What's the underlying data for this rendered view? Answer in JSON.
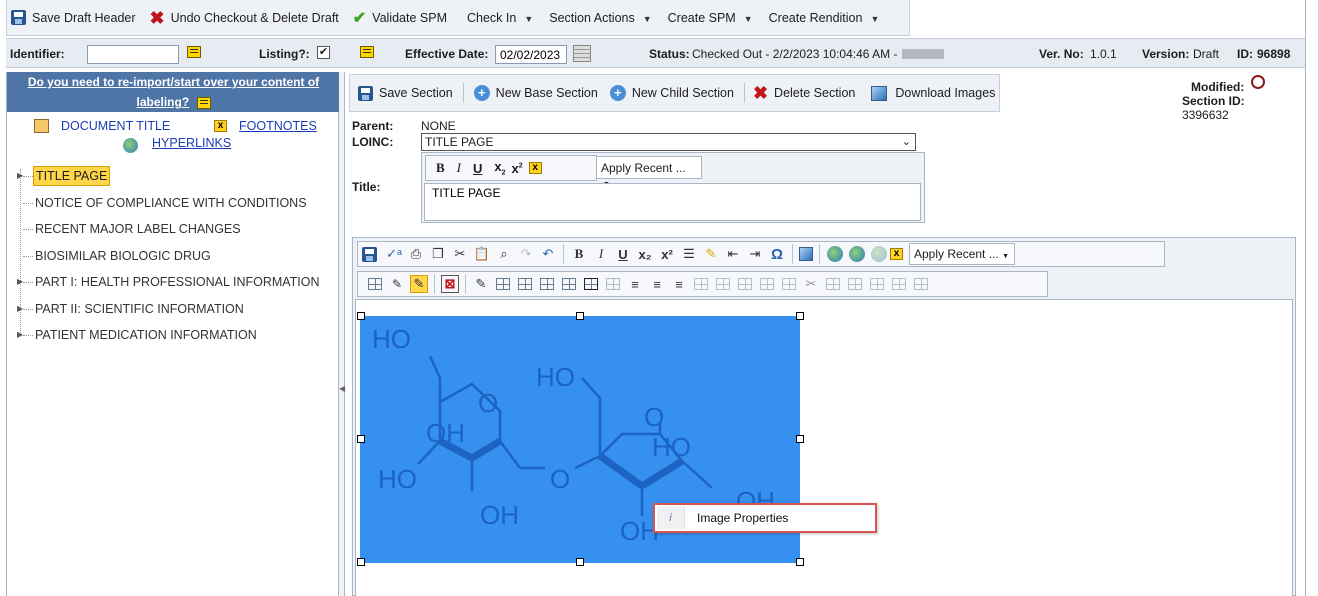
{
  "top_toolbar": {
    "save_draft_header": "Save Draft Header",
    "undo_checkout": "Undo Checkout & Delete Draft",
    "validate_spm": "Validate SPM",
    "check_in": "Check In",
    "section_actions": "Section Actions",
    "create_spm": "Create SPM",
    "create_rendition": "Create Rendition"
  },
  "info_bar": {
    "identifier_label": "Identifier:",
    "identifier_value": "",
    "listing_label": "Listing?:",
    "listing_checked": true,
    "effective_date_label": "Effective Date:",
    "effective_date_value": "02/02/2023",
    "status_label": "Status:",
    "status_value": "Checked Out - 2/2/2023 10:04:46 AM -",
    "ver_no_label": "Ver. No:",
    "ver_no_value": "1.0.1",
    "version_label": "Version:",
    "version_value": "Draft",
    "id_label": "ID:",
    "id_value": "96898"
  },
  "left_panel": {
    "reimport_line1": "Do you need to re-import/start over your content of",
    "reimport_line2": "labeling?",
    "document_title": "DOCUMENT TITLE",
    "footnotes": "FOOTNOTES",
    "hyperlinks": "HYPERLINKS",
    "tree": [
      {
        "label": "TITLE PAGE",
        "selected": true,
        "expandable": true
      },
      {
        "label": "NOTICE OF COMPLIANCE WITH CONDITIONS",
        "selected": false,
        "expandable": false
      },
      {
        "label": "RECENT MAJOR LABEL CHANGES",
        "selected": false,
        "expandable": false
      },
      {
        "label": "BIOSIMILAR BIOLOGIC DRUG",
        "selected": false,
        "expandable": false
      },
      {
        "label": "PART I: HEALTH PROFESSIONAL INFORMATION",
        "selected": false,
        "expandable": true
      },
      {
        "label": "PART II: SCIENTIFIC INFORMATION",
        "selected": false,
        "expandable": true
      },
      {
        "label": "PATIENT MEDICATION INFORMATION",
        "selected": false,
        "expandable": true
      }
    ]
  },
  "section_toolbar": {
    "save_section": "Save Section",
    "new_base_section": "New Base Section",
    "new_child_section": "New Child Section",
    "delete_section": "Delete Section",
    "download_images": "Download Images"
  },
  "section_meta": {
    "modified_label": "Modified:",
    "section_id_label": "Section ID:",
    "section_id_value": "3396632"
  },
  "section_form": {
    "parent_label": "Parent:",
    "parent_value": "NONE",
    "loinc_label": "LOINC:",
    "loinc_value": "TITLE PAGE",
    "title_label": "Title:",
    "title_value": "TITLE PAGE",
    "apply_recent": "Apply Recent ..."
  },
  "editor": {
    "apply_recent": "Apply Recent ...",
    "image_labels": [
      "HO",
      "HO",
      "O",
      "OH",
      "HO",
      "OH",
      "O",
      "O",
      "HO",
      "OH",
      "OH"
    ],
    "image_bg_color": "#3590ef"
  },
  "context_menu": {
    "image_properties": "Image Properties"
  }
}
